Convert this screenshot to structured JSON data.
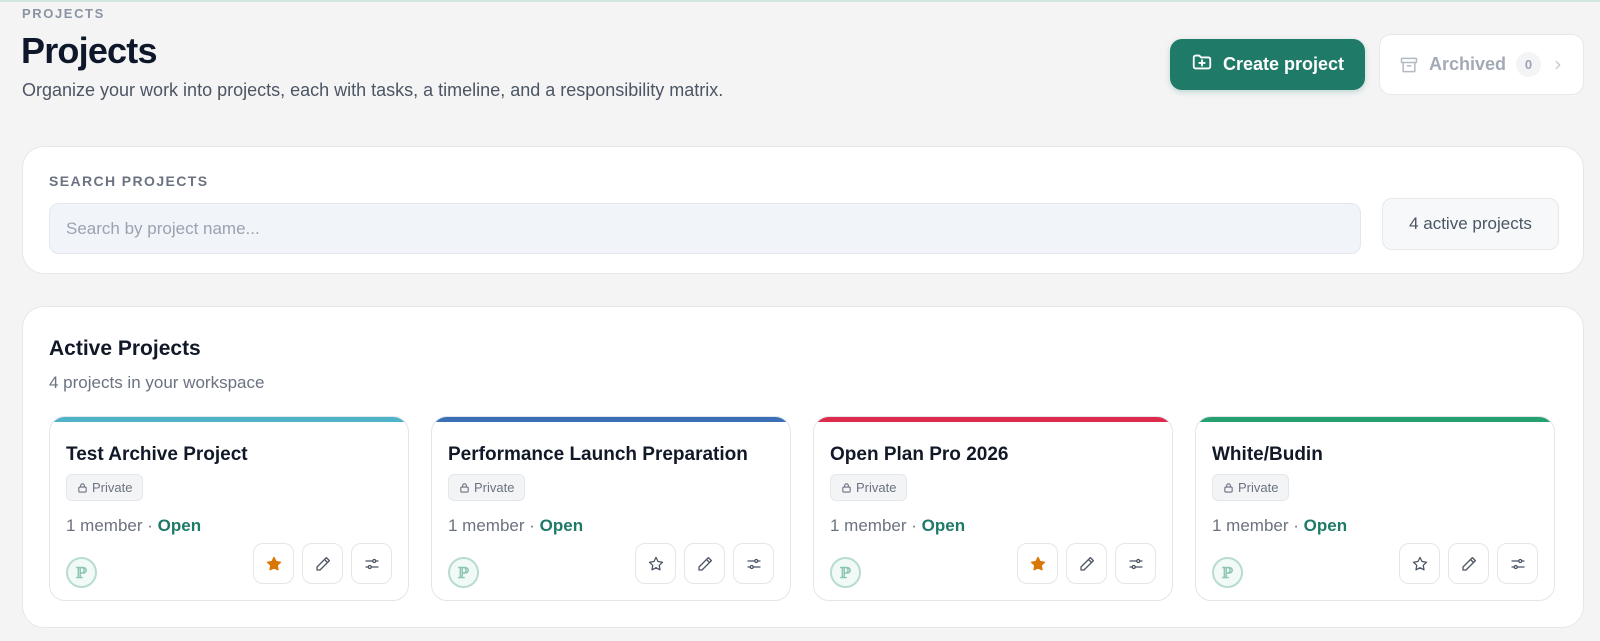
{
  "header": {
    "eyebrow": "PROJECTS",
    "title": "Projects",
    "subtitle": "Organize your work into projects, each with tasks, a timeline, and a responsibility matrix."
  },
  "actions": {
    "create_label": "Create project",
    "archived_label": "Archived",
    "archived_count": "0"
  },
  "search": {
    "label": "SEARCH PROJECTS",
    "placeholder": "Search by project name...",
    "value": "",
    "active_count_label": "4 active projects"
  },
  "projects_section": {
    "title": "Active Projects",
    "subtitle": "4 projects in your workspace"
  },
  "projects": [
    {
      "name": "Test Archive Project",
      "visibility": "Private",
      "members": "1 member",
      "separator": "·",
      "status": "Open",
      "accent": "#4fb3c8",
      "starred": true,
      "avatar": "ℙ"
    },
    {
      "name": "Performance Launch Preparation",
      "visibility": "Private",
      "members": "1 member",
      "separator": "·",
      "status": "Open",
      "accent": "#3b6fb6",
      "starred": false,
      "avatar": "ℙ"
    },
    {
      "name": "Open Plan Pro 2026",
      "visibility": "Private",
      "members": "1 member",
      "separator": "·",
      "status": "Open",
      "accent": "#dc2b4b",
      "starred": true,
      "avatar": "ℙ"
    },
    {
      "name": "White/Budin",
      "visibility": "Private",
      "members": "1 member",
      "separator": "·",
      "status": "Open",
      "accent": "#27a070",
      "starred": false,
      "avatar": "ℙ"
    }
  ],
  "colors": {
    "brand": "#1f7a68",
    "star_active": "#d97706",
    "background": "#f4f4f5"
  },
  "icons": {
    "create": "folder-plus-icon",
    "archived": "archive-box-icon",
    "chevron": "chevron-right-icon",
    "lock": "lock-icon",
    "star": "star-icon",
    "edit": "pencil-icon",
    "settings": "sliders-icon"
  }
}
